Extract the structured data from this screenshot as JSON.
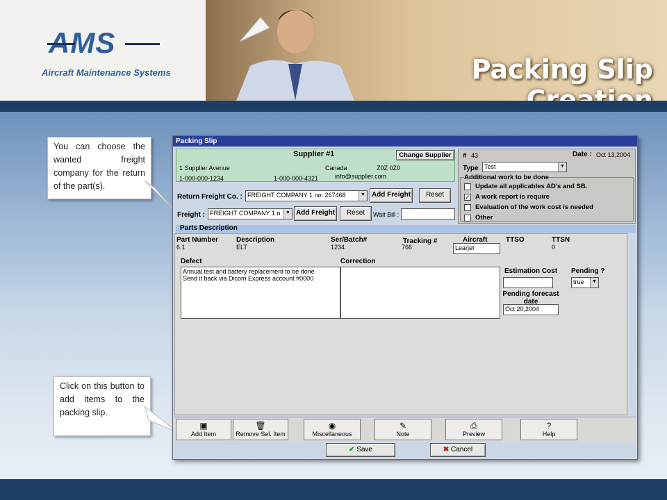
{
  "slide": {
    "title": "Packing Slip Creation",
    "logo": "AMS",
    "logo_sub": "Aircraft Maintenance Systems"
  },
  "callouts": {
    "freight": "You can choose the wanted freight company for the return of the part(s).",
    "add_item": "Click on this button to add items to the packing slip."
  },
  "window": {
    "title": "Packing Slip"
  },
  "supplier": {
    "name": "Supplier #1",
    "change_label": "Change Supplier",
    "address": "1 Supplier Avenue",
    "country": "Canada",
    "postal": "Z0Z 0Z0",
    "phone1": "1-000-000-1234",
    "phone2": "1-000-000-4321",
    "email": "info@supplier.com"
  },
  "slip": {
    "number_label": "#",
    "number": "43",
    "date_label": "Date :",
    "date": "Oct 13,2004",
    "type_label": "Type",
    "type_value": "Test"
  },
  "additional": {
    "title": "Additional work to be done",
    "items": [
      {
        "label": "Update all applicables AD's and SB.",
        "checked": ""
      },
      {
        "label": "A work report is require",
        "checked": "✓"
      },
      {
        "label": "Evaluation of the work cost is needed",
        "checked": ""
      },
      {
        "label": "Other",
        "checked": ""
      }
    ]
  },
  "return_freight": {
    "label": "Return Freight Co. :",
    "value": "FREIGHT COMPANY 1 no: 267468",
    "add_label": "Add Freight",
    "reset_label": "Reset"
  },
  "freight": {
    "label": "Freight :",
    "value": "FREIGHT COMPANY 1 n",
    "add_label": "Add Freight",
    "reset_label": "Reset",
    "waybill_label": "Wait Bill :",
    "waybill_value": ""
  },
  "parts": {
    "section_title": "Parts Description",
    "headers": {
      "part": "Part Number",
      "desc": "Description",
      "serial": "Ser/Batch#",
      "tracking": "Tracking #",
      "aircraft": "Aircraft",
      "ttso": "TTSO",
      "ttsn": "TTSN"
    },
    "row": {
      "part": "6.1",
      "desc": "ELT",
      "serial": "1234",
      "tracking": "766",
      "aircraft": "Learjet",
      "ttsn": "0"
    },
    "defect_label": "Defect",
    "defect_text": "Annual test and battery replacement to be done\nSend it back via Dicom Express account #0000",
    "correction_label": "Correction",
    "est_label": "Estimation Cost",
    "est_value": "",
    "pending_label": "Pending ?",
    "pending_value": "true",
    "forecast_label": "Pending forecast date",
    "forecast_value": "Oct 20,2004"
  },
  "toolbar": {
    "add_item": "Add Item",
    "remove": "Remove Sel. Item",
    "misc": "Miscellaneous",
    "note": "Note",
    "preview": "Preview",
    "help": "Help"
  },
  "footer": {
    "save": "Save",
    "cancel": "Cancel"
  },
  "colors": {
    "title_bar": "#2b3f9a",
    "supplier_bg": "#bfe0c8",
    "window_bg": "#ccd7e6"
  }
}
